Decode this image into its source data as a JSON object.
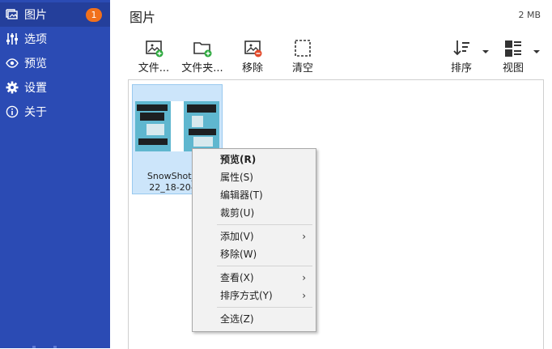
{
  "sidebar": {
    "items": [
      {
        "label": "图片",
        "icon": "pictures-icon",
        "badge": "1"
      },
      {
        "label": "选项",
        "icon": "sliders-icon"
      },
      {
        "label": "预览",
        "icon": "eye-icon"
      },
      {
        "label": "设置",
        "icon": "gear-icon"
      },
      {
        "label": "关于",
        "icon": "info-icon"
      }
    ]
  },
  "header": {
    "title": "图片",
    "size": "2 MB"
  },
  "toolbar": {
    "add_files": "文件...",
    "add_folder": "文件夹...",
    "remove": "移除",
    "clear": "清空",
    "sort": "排序",
    "view": "视图"
  },
  "thumbnail": {
    "caption_line1": "SnowShot_20",
    "caption_line2": "22_18-20-48"
  },
  "context_menu": {
    "preview": "预览(R)",
    "properties": "属性(S)",
    "editor": "编辑器(T)",
    "crop": "裁剪(U)",
    "add": "添加(V)",
    "remove": "移除(W)",
    "view": "查看(X)",
    "sort_by": "排序方式(Y)",
    "select_all": "全选(Z)",
    "submenu_arrow": "›"
  },
  "colors": {
    "sidebar": "#2b4bb4",
    "badge": "#f1701c",
    "selection": "#cce5fa"
  }
}
